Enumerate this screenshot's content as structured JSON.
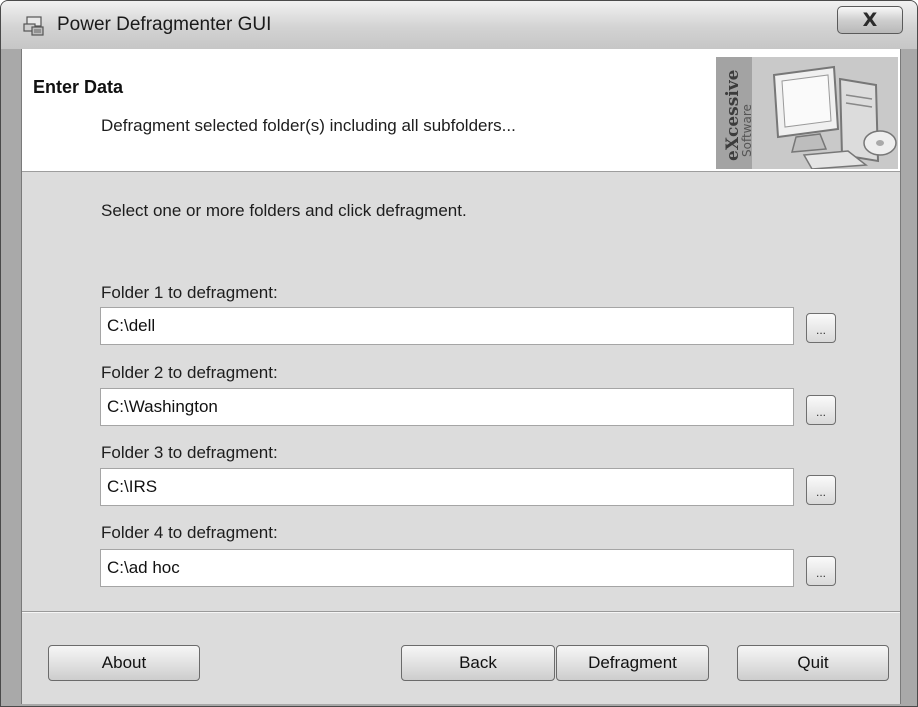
{
  "window": {
    "title": "Power Defragmenter GUI",
    "close_label": "X"
  },
  "header": {
    "title": "Enter Data",
    "subtitle": "Defragment selected folder(s) including all subfolders...",
    "brand_line1": "eXcessive",
    "brand_line2": "Software"
  },
  "main": {
    "instruction": "Select one or more folders and click defragment.",
    "folders": [
      {
        "label": "Folder 1 to defragment:",
        "value": "C:\\dell",
        "browse_label": "..."
      },
      {
        "label": "Folder 2 to defragment:",
        "value": "C:\\Washington",
        "browse_label": "..."
      },
      {
        "label": "Folder 3 to defragment:",
        "value": "C:\\IRS",
        "browse_label": "..."
      },
      {
        "label": "Folder 4 to defragment:",
        "value": "C:\\ad hoc",
        "browse_label": "..."
      }
    ]
  },
  "buttons": {
    "about": "About",
    "back": "Back",
    "defragment": "Defragment",
    "quit": "Quit"
  }
}
